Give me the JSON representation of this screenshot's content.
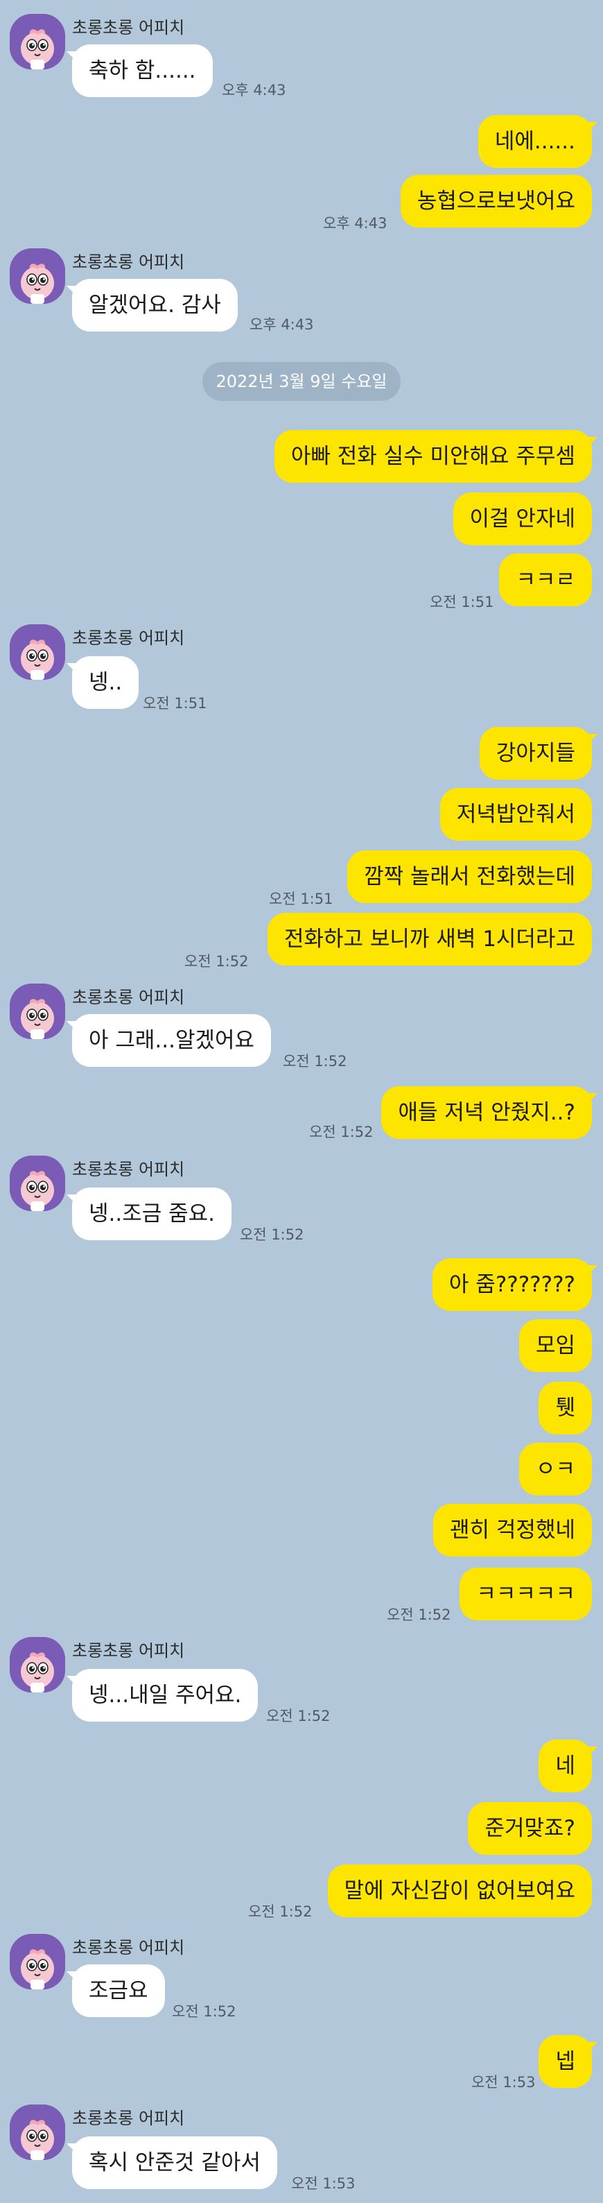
{
  "sender_name": "초롱초롱 어피치",
  "date_divider": "2022년 3월 9일 수요일",
  "messages": [
    {
      "text": "축하  함......",
      "time": "오후 4:43"
    },
    {
      "text": "네에......"
    },
    {
      "text": "농협으로보냇어요",
      "time": "오후 4:43"
    },
    {
      "text": "알겠어요. 감사",
      "time": "오후 4:43"
    },
    {
      "text": "아빠 전화 실수 미안해요 주무셈"
    },
    {
      "text": "이걸 안자네"
    },
    {
      "text": "ㅋㅋㄹ",
      "time": "오전 1:51"
    },
    {
      "text": "넹..",
      "time": "오전 1:51"
    },
    {
      "text": "강아지들"
    },
    {
      "text": "저녁밥안줘서"
    },
    {
      "text": "깜짝 놀래서 전화했는데",
      "time": "오전 1:51"
    },
    {
      "text": "전화하고 보니까 새벽 1시더라고",
      "time": "오전 1:52"
    },
    {
      "text": "아 그래...알겠어요",
      "time": "오전 1:52"
    },
    {
      "text": "애들 저녁 안줬지..?",
      "time": "오전 1:52"
    },
    {
      "text": "넹..조금 줌요.",
      "time": "오전 1:52"
    },
    {
      "text": "아 줌???????"
    },
    {
      "text": "모임"
    },
    {
      "text": "퉷"
    },
    {
      "text": "ㅇㅋ"
    },
    {
      "text": "괜히 걱정했네"
    },
    {
      "text": "ㅋㅋㅋㅋㅋ",
      "time": "오전 1:52"
    },
    {
      "text": "넹...내일 주어요.",
      "time": "오전 1:52"
    },
    {
      "text": "네"
    },
    {
      "text": "준거맞죠?"
    },
    {
      "text": "말에 자신감이 없어보여요",
      "time": "오전 1:52"
    },
    {
      "text": "조금요",
      "time": "오전 1:52"
    },
    {
      "text": "넵",
      "time": "오전 1:53"
    },
    {
      "text": "혹시 안준것 같아서",
      "time": "오전 1:53"
    }
  ],
  "colors": {
    "background": "#b2c7da",
    "incoming_bubble": "#ffffff",
    "outgoing_bubble": "#fee500",
    "date_pill": "#9fb3c7",
    "avatar_bg": "#7a5bb5"
  },
  "icons": {
    "avatar": "apeach-character-icon"
  }
}
